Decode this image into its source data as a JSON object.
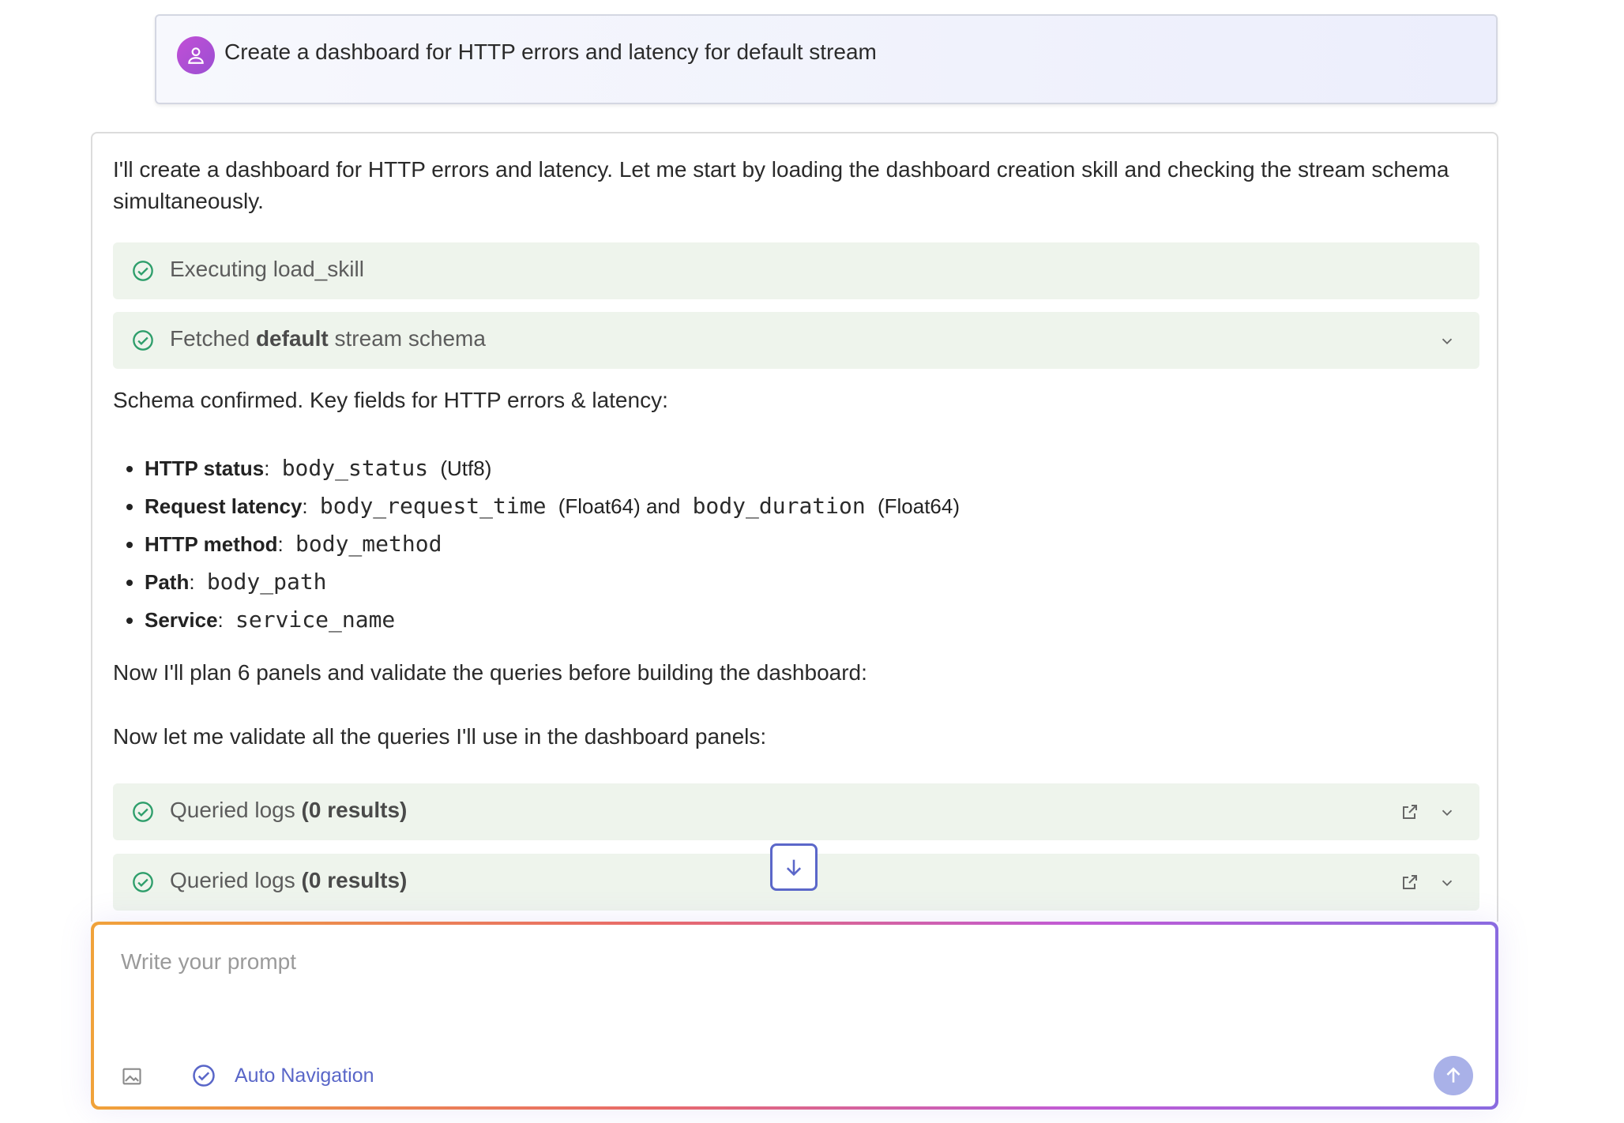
{
  "user_message": {
    "text": "Create a dashboard for HTTP errors and latency for default stream"
  },
  "assistant": {
    "intro": "I'll create a dashboard for HTTP errors and latency. Let me start by loading the dashboard creation skill and checking the stream schema simultaneously.",
    "tools": [
      {
        "label": "Executing load_skill"
      },
      {
        "prefix": "Fetched ",
        "bold": "default",
        "suffix": " stream schema"
      }
    ],
    "schema_confirmed": "Schema confirmed. Key fields for HTTP errors & latency:",
    "fields": [
      {
        "name": "HTTP status",
        "sep": ":",
        "code": "body_status",
        "type": "(Utf8)"
      },
      {
        "name": "Request latency",
        "sep": ":",
        "code": "body_request_time",
        "type": "(Float64) and",
        "code2": "body_duration",
        "type2": "(Float64)"
      },
      {
        "name": "HTTP method",
        "sep": ":",
        "code": "body_method"
      },
      {
        "name": "Path",
        "sep": ":",
        "code": "body_path"
      },
      {
        "name": "Service",
        "sep": ":",
        "code": "service_name"
      }
    ],
    "plan_text": "Now I'll plan 6 panels and validate the queries before building the dashboard:",
    "validate_text": "Now let me validate all the queries I'll use in the dashboard panels:",
    "queries": [
      {
        "prefix": "Queried logs ",
        "bold": "(0 results)"
      },
      {
        "prefix": "Queried logs ",
        "bold": "(0 results)"
      }
    ]
  },
  "prompt": {
    "placeholder": "Write your prompt",
    "auto_navigation_label": "Auto Navigation"
  },
  "colors": {
    "tool_bg": "#eef4ec",
    "check_green": "#2e9e6b",
    "accent": "#5966c8",
    "avatar": "#b84fd4"
  },
  "icons": [
    "user-icon",
    "check-circle-icon",
    "chevron-down-icon",
    "external-link-icon",
    "arrow-down-icon",
    "image-icon",
    "arrow-up-icon"
  ]
}
